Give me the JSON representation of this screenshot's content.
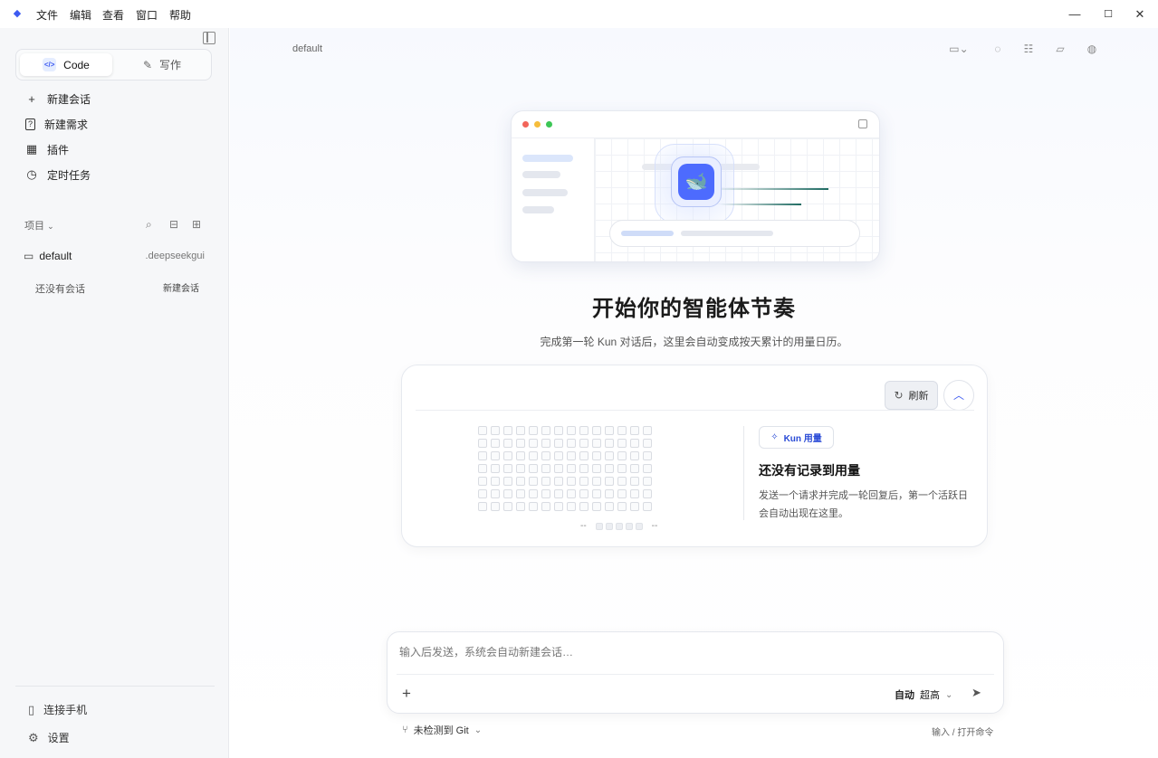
{
  "menubar": {
    "items": [
      "文件",
      "编辑",
      "查看",
      "窗口",
      "帮助"
    ],
    "minimize": "—",
    "maximize": "☐",
    "close": "✕"
  },
  "sidebar": {
    "mode_tabs": [
      {
        "label": "Code",
        "icon": "code-icon",
        "active": true
      },
      {
        "label": "写作",
        "icon": "pen-icon",
        "active": false
      }
    ],
    "nav": [
      {
        "label": "新建会话",
        "icon": "plus-icon",
        "glyph": "+"
      },
      {
        "label": "新建需求",
        "icon": "question-doc-icon",
        "glyph": "?"
      },
      {
        "label": "插件",
        "icon": "grid-icon",
        "glyph": "▦"
      },
      {
        "label": "定时任务",
        "icon": "clock-icon",
        "glyph": "◷"
      }
    ],
    "projects_label": "项目",
    "project": {
      "name": "default",
      "path": ".deepseekgui"
    },
    "empty_text": "还没有会话",
    "new_session_label": "新建会话",
    "bottom": [
      {
        "label": "连接手机",
        "icon": "phone-icon",
        "glyph": "▯"
      },
      {
        "label": "设置",
        "icon": "gear-icon",
        "glyph": "⚙"
      }
    ]
  },
  "main": {
    "breadcrumb": "default",
    "hero_title": "开始你的智能体节奏",
    "hero_subtitle": "完成第一轮 Kun 对话后，这里会自动变成按天累计的用量日历。",
    "usage": {
      "refresh_label": "刷新",
      "badge": "Kun 用量",
      "title": "还没有记录到用量",
      "description": "发送一个请求并完成一轮回复后，第一个活跃日会自动出现在这里。",
      "legend_start": "--",
      "legend_end": "--",
      "grid_rows": 7,
      "grid_cols": 14
    },
    "composer": {
      "placeholder": "输入后发送，系统会自动新建会话…",
      "mode": "自动",
      "effort": "超高"
    },
    "git_status": "未检测到 Git",
    "command_hint": "输入 / 打开命令"
  },
  "colors": {
    "accent": "#3d5af1",
    "brand_whale": "#4d6bfe"
  }
}
